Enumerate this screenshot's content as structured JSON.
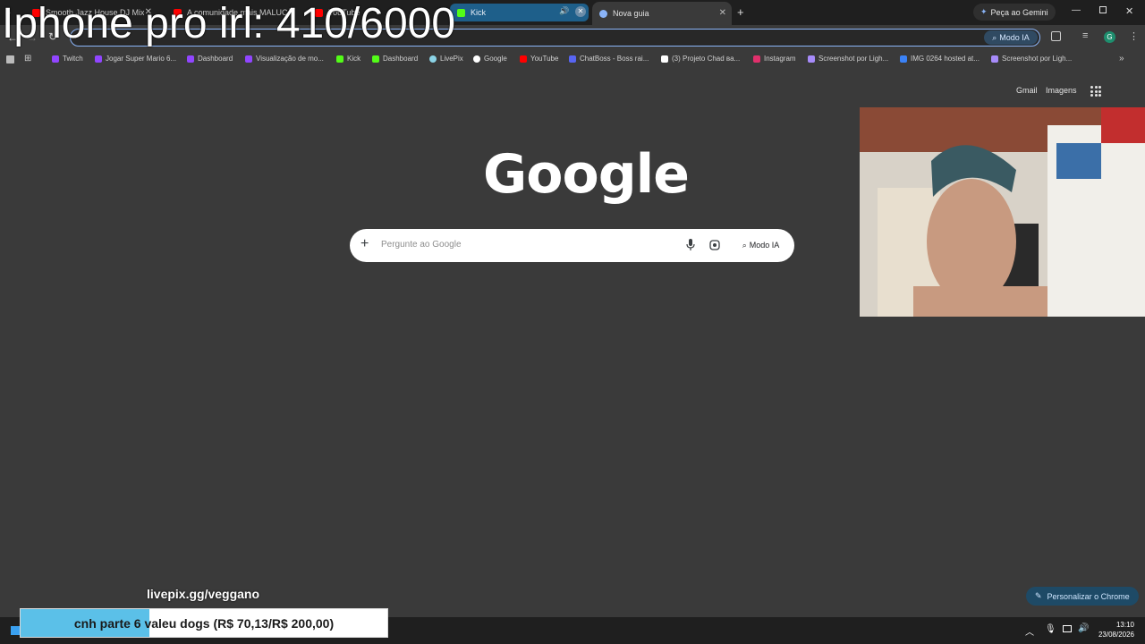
{
  "overlay": {
    "headline": "Iphone pro irl: 410/6000"
  },
  "tabs": [
    {
      "title": "Smooth Jazz House DJ Mix - Co",
      "favicon": "youtube-icon",
      "color": "#ff0000"
    },
    {
      "title": "A comunidade mais MALUCA d",
      "favicon": "youtube-icon",
      "color": "#ff0000"
    },
    {
      "title": "YouTube",
      "favicon": "youtube-icon",
      "color": "#ff0000"
    },
    {
      "title": "Kick",
      "favicon": "kick-icon",
      "color": "#53fc18",
      "active_audio": true
    },
    {
      "title": "Nova guia",
      "favicon": "chrome-icon",
      "color": "#8ab4f8",
      "selected": true
    }
  ],
  "header": {
    "gemini_label": "Peça ao Gemini"
  },
  "omnibox": {
    "modo_ia_label": "Modo IA"
  },
  "bookmarks": [
    {
      "label": "Twitch",
      "color": "#9146ff"
    },
    {
      "label": "Jogar Super Mario 6...",
      "color": "#9146ff"
    },
    {
      "label": "Dashboard",
      "color": "#9146ff"
    },
    {
      "label": "Visualização de mo...",
      "color": "#9146ff"
    },
    {
      "label": "Kick",
      "color": "#53fc18"
    },
    {
      "label": "Dashboard",
      "color": "#53fc18"
    },
    {
      "label": "LivePix",
      "color": "#8bd3e6"
    },
    {
      "label": "Google",
      "color": "#ffffff"
    },
    {
      "label": "YouTube",
      "color": "#ff0000"
    },
    {
      "label": "ChatBoss - Boss rai...",
      "color": "#5865f2"
    },
    {
      "label": "(3) Projeto Chad ва...",
      "color": "#ffffff"
    },
    {
      "label": "Instagram",
      "color": "#e1306c"
    },
    {
      "label": "Screenshot por Ligh...",
      "color": "#a78bfa"
    },
    {
      "label": "IMG 0264 hosted at...",
      "color": "#3b82f6"
    },
    {
      "label": "Screenshot por Ligh...",
      "color": "#a78bfa"
    }
  ],
  "google": {
    "gmail": "Gmail",
    "imagens": "Imagens",
    "logo": "Google",
    "search_placeholder": "Pergunte ao Google",
    "modo_ia": "Modo IA",
    "personalizar": "Personalizar o Chrome"
  },
  "stream": {
    "livepix_url": "livepix.gg/veggano",
    "goal_text": "cnh parte 6 valeu dogs (R$ 70,13/R$ 200,00)",
    "goal_current": 70.13,
    "goal_total": 200.0
  },
  "taskbar": {
    "time": "13:10",
    "date": "23/08/2026"
  }
}
